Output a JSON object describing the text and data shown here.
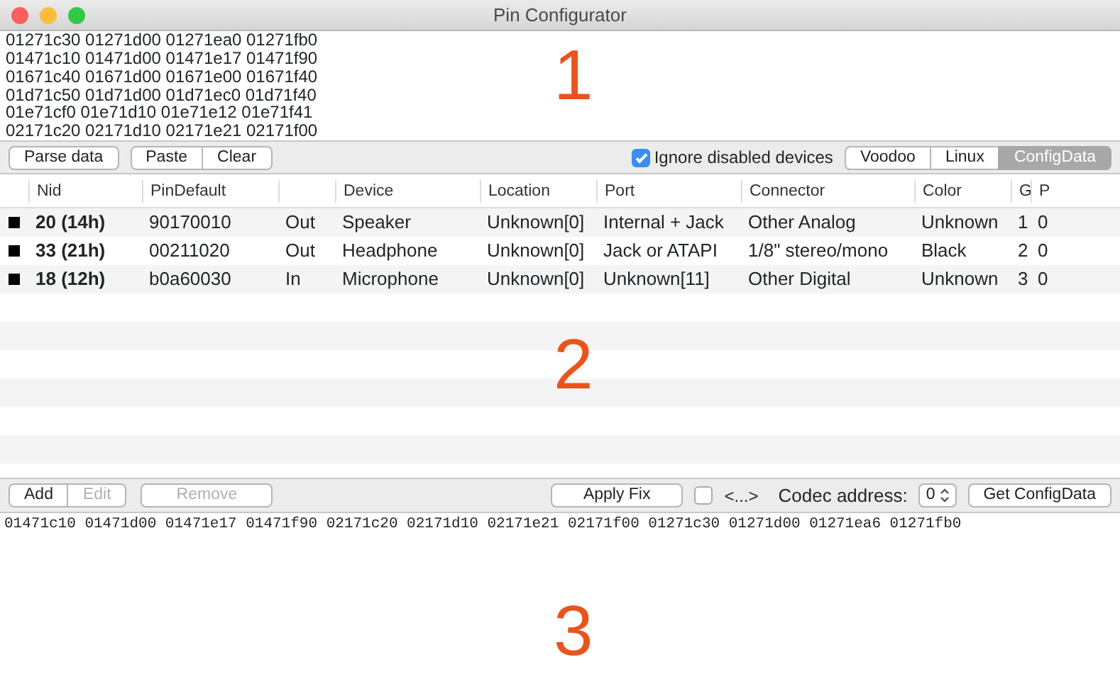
{
  "window": {
    "title": "Pin Configurator"
  },
  "config_input": {
    "lines": [
      "01271c30 01271d00 01271ea0 01271fb0",
      "01471c10 01471d00 01471e17 01471f90",
      "01671c40 01671d00 01671e00 01671f40",
      "01d71c50 01d71d00 01d71ec0 01d71f40",
      "01e71cf0 01e71d10 01e71e12 01e71f41",
      "02171c20 02171d10 02171e21 02171f00"
    ]
  },
  "top_toolbar": {
    "parse_button": "Parse data",
    "paste_button": "Paste",
    "clear_button": "Clear",
    "ignore_disabled": {
      "label": "Ignore disabled devices",
      "checked": true
    },
    "format_tabs": [
      {
        "label": "Voodoo",
        "selected": false
      },
      {
        "label": "Linux",
        "selected": false
      },
      {
        "label": "ConfigData",
        "selected": true
      }
    ]
  },
  "table": {
    "columns": [
      {
        "label": "Nid"
      },
      {
        "label": "PinDefault"
      },
      {},
      {
        "label": "Device"
      },
      {
        "label": "Location"
      },
      {
        "label": "Port"
      },
      {
        "label": "Connector"
      },
      {
        "label": "Color"
      },
      {
        "label": "G"
      },
      {
        "label": "P"
      }
    ],
    "rows": [
      {
        "cells": [
          "20 (14h)",
          "90170010",
          "Out",
          "Speaker",
          "Unknown[0]",
          "Internal + Jack",
          "Other Analog",
          "Unknown",
          "1",
          "0"
        ]
      },
      {
        "cells": [
          "33 (21h)",
          "00211020",
          "Out",
          "Headphone",
          "Unknown[0]",
          "Jack or ATAPI",
          "1/8\" stereo/mono",
          "Black",
          "2",
          "0"
        ]
      },
      {
        "cells": [
          "18 (12h)",
          "b0a60030",
          "In",
          "Microphone",
          "Unknown[0]",
          "Unknown[11]",
          "Other Digital",
          "Unknown",
          "3",
          "0"
        ]
      }
    ]
  },
  "bottom_toolbar": {
    "buttons": [
      {
        "label": "Add",
        "disabled": false
      },
      {
        "label": "Edit",
        "disabled": true
      },
      {
        "label": "Remove",
        "disabled": true
      }
    ],
    "apply_button": "Apply Fix",
    "option": {
      "label": "<...>",
      "checked": false
    },
    "codec_label": "Codec address:",
    "codec_value": "0",
    "get_button": "Get ConfigData"
  },
  "output": {
    "text": "01471c10 01471d00 01471e17 01471f90 02171c20 02171d10 02171e21 02171f00 01271c30 01271d00 01271ea6 01271fb0"
  },
  "annotations": [
    "1",
    "2",
    "3"
  ]
}
